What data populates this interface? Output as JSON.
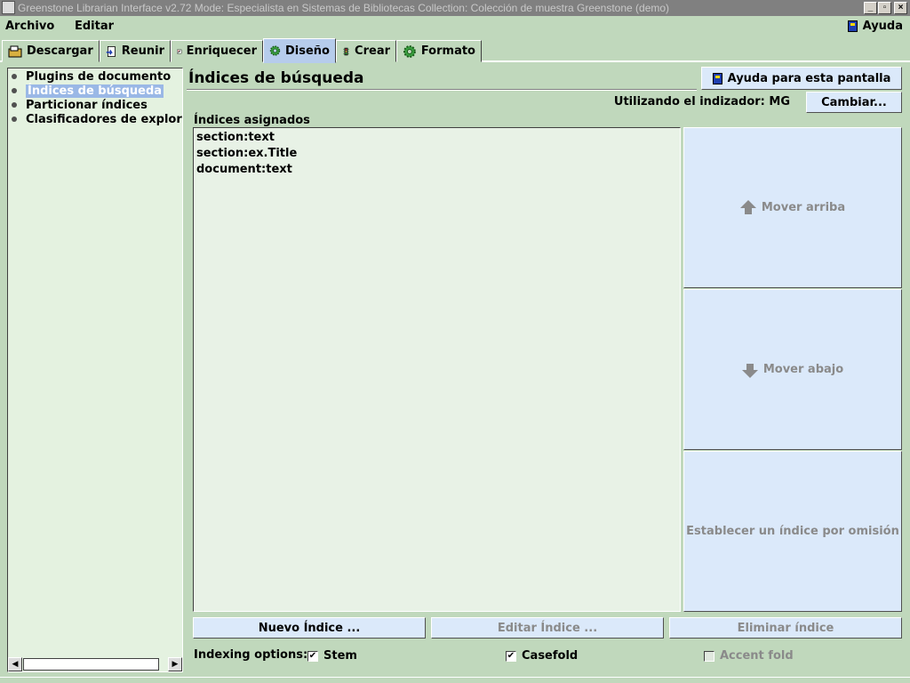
{
  "window": {
    "title": "Greenstone Librarian Interface v2.72  Mode: Especialista en Sistemas de Bibliotecas  Collection: Colección de muestra Greenstone (demo)"
  },
  "menu": {
    "file": "Archivo",
    "edit": "Editar",
    "help": "Ayuda"
  },
  "tabs": [
    {
      "label": "Descargar",
      "icon": "download-icon"
    },
    {
      "label": "Reunir",
      "icon": "gather-icon"
    },
    {
      "label": "Enriquecer",
      "icon": "enrich-icon"
    },
    {
      "label": "Diseño",
      "icon": "design-gear-icon",
      "active": true
    },
    {
      "label": "Crear",
      "icon": "create-traffic-light-icon"
    },
    {
      "label": "Formato",
      "icon": "format-gear-icon"
    }
  ],
  "tree": [
    {
      "label": "Plugins de documento"
    },
    {
      "label": "Índices de búsqueda",
      "selected": true
    },
    {
      "label": "Particionar índices"
    },
    {
      "label": "Clasificadores de exploración"
    }
  ],
  "page": {
    "title": "Índices de búsqueda",
    "help_button": "Ayuda para esta pantalla",
    "indexer_label": "Utilizando el indizador: MG",
    "change_button": "Cambiar...",
    "assigned_label": "Índices asignados"
  },
  "indexes": [
    "section:text",
    "section:ex.Title",
    "document:text"
  ],
  "side_buttons": {
    "move_up": "Mover arriba",
    "move_down": "Mover abajo",
    "set_default": "Establecer un índice por omisión"
  },
  "bottom_buttons": {
    "new": "Nuevo Índice  ...",
    "edit": "Editar Índice  ...",
    "delete": "Eliminar índice"
  },
  "options": {
    "label": "Indexing options:",
    "stem": {
      "label": "Stem",
      "checked": true
    },
    "casefold": {
      "label": "Casefold",
      "checked": true
    },
    "accentfold": {
      "label": "Accent fold",
      "checked": false,
      "disabled": true
    }
  },
  "colors": {
    "background": "#c0d8bc",
    "button": "#dbe9fa",
    "selection": "#9ab8e6",
    "list": "#e8f2e6"
  }
}
